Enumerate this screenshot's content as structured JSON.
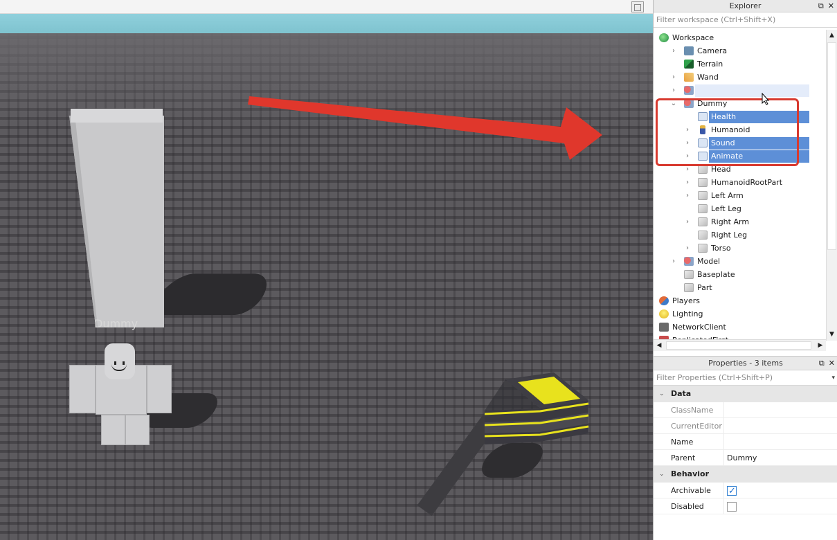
{
  "explorer": {
    "title": "Explorer",
    "filter_placeholder": "Filter workspace (Ctrl+Shift+X)",
    "items": [
      {
        "label": "Workspace",
        "icon": "workspace-icon"
      },
      {
        "label": "Camera",
        "icon": "camera-icon"
      },
      {
        "label": "Terrain",
        "icon": "terrain-icon"
      },
      {
        "label": "Wand",
        "icon": "tool-icon"
      },
      {
        "label": "",
        "icon": "model-icon"
      },
      {
        "label": "Dummy",
        "icon": "model-icon"
      },
      {
        "label": "Health",
        "icon": "script-icon"
      },
      {
        "label": "Humanoid",
        "icon": "humanoid-icon"
      },
      {
        "label": "Sound",
        "icon": "script-icon"
      },
      {
        "label": "Animate",
        "icon": "script-icon"
      },
      {
        "label": "Head",
        "icon": "part-icon"
      },
      {
        "label": "HumanoidRootPart",
        "icon": "part-icon"
      },
      {
        "label": "Left Arm",
        "icon": "part-icon"
      },
      {
        "label": "Left Leg",
        "icon": "part-icon"
      },
      {
        "label": "Right Arm",
        "icon": "part-icon"
      },
      {
        "label": "Right Leg",
        "icon": "part-icon"
      },
      {
        "label": "Torso",
        "icon": "part-icon"
      },
      {
        "label": "Model",
        "icon": "model-icon"
      },
      {
        "label": "Baseplate",
        "icon": "part-icon"
      },
      {
        "label": "Part",
        "icon": "part-icon"
      },
      {
        "label": "Players",
        "icon": "players-icon"
      },
      {
        "label": "Lighting",
        "icon": "lighting-icon"
      },
      {
        "label": "NetworkClient",
        "icon": "network-icon"
      },
      {
        "label": "ReplicatedFirst",
        "icon": "replicated-icon"
      }
    ]
  },
  "properties": {
    "title": "Properties - 3 items",
    "filter_placeholder": "Filter Properties (Ctrl+Shift+P)",
    "sections": [
      {
        "name": "Data"
      },
      {
        "name": "Behavior"
      }
    ],
    "rows": {
      "classname": {
        "key": "ClassName",
        "value": ""
      },
      "currenteditor": {
        "key": "CurrentEditor",
        "value": ""
      },
      "name": {
        "key": "Name",
        "value": ""
      },
      "parent": {
        "key": "Parent",
        "value": "Dummy"
      },
      "archivable": {
        "key": "Archivable",
        "checked": true
      },
      "disabled": {
        "key": "Disabled",
        "checked": false
      }
    }
  },
  "viewport": {
    "dummy_label": "Dummy"
  },
  "colors": {
    "selection": "#5d8fd7",
    "annotation_red": "#d83a2f"
  }
}
